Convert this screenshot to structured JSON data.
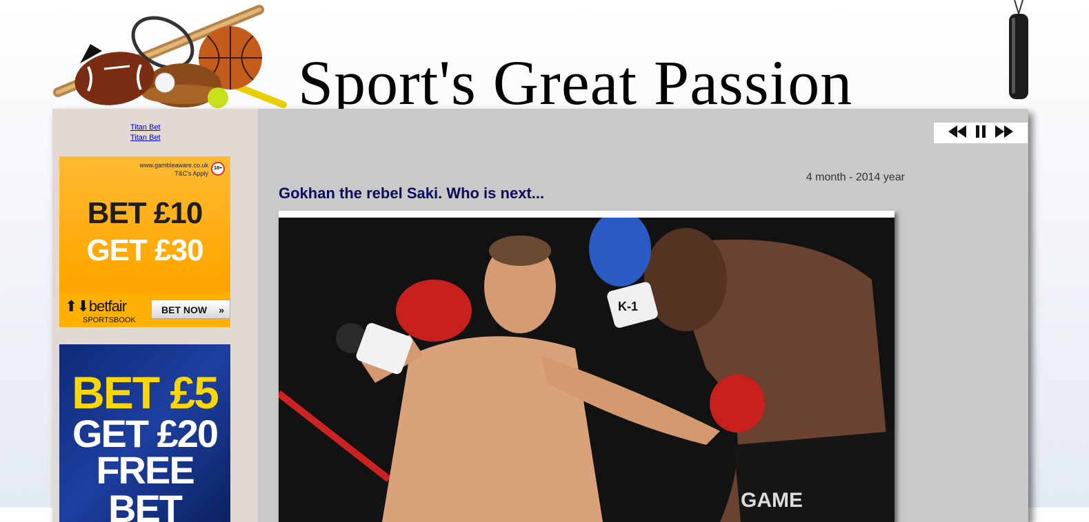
{
  "header": {
    "site_title": "Sport's Great Passion"
  },
  "sidebar": {
    "links": [
      "Titan Bet",
      "Titan Bet"
    ],
    "ad_betfair": {
      "gambleaware": "www.gambleaware.co.uk",
      "tcs": "T&C's Apply",
      "age_badge": "18+",
      "line1": "BET £10",
      "line2": "GET £30",
      "brand": "betfair",
      "brand_sub": "SPORTSBOOK",
      "button": "BET NOW"
    },
    "ad_free_bet": {
      "line1": "BET £5",
      "line2": "GET £20",
      "line3": "FREE BET"
    }
  },
  "media_controls": {
    "icons": [
      "rewind-icon",
      "pause-icon",
      "fast-forward-icon"
    ]
  },
  "post": {
    "date": "4 month - 2014 year",
    "title": "Gokhan the rebel Saki. Who is next...",
    "image_text": {
      "glove_label": "K-1",
      "shorts_label": "GAME"
    }
  },
  "colors": {
    "title_color": "#0b0b5b",
    "content_bg": "#c9c9c9",
    "sidebar_bg": "#e2d9d4"
  }
}
